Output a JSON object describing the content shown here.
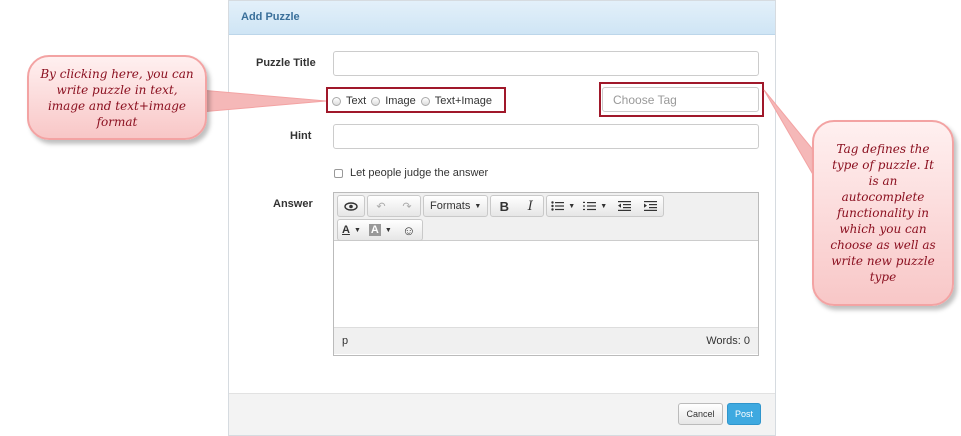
{
  "modal": {
    "title": "Add Puzzle",
    "fields": {
      "title_label": "Puzzle Title",
      "title_value": "",
      "hint_label": "Hint",
      "hint_value": "",
      "tag_placeholder": "Choose Tag",
      "answer_label": "Answer"
    },
    "format_options": [
      "Text",
      "Image",
      "Text+Image"
    ],
    "judge_label": "Let people judge the answer",
    "editor": {
      "formats_label": "Formats",
      "bold": "B",
      "italic": "I",
      "font_color": "A",
      "bg_color": "A",
      "status_path": "p",
      "word_count": "Words: 0"
    },
    "buttons": {
      "cancel": "Cancel",
      "post": "Post"
    }
  },
  "annotations": {
    "left_callout": "By clicking here, you can write puzzle in text, image and text+image format",
    "right_callout": "Tag defines the type of puzzle. It is an autocomplete functionality in which you can choose as well as write new puzzle type"
  },
  "colors": {
    "header_text": "#3a6f9a",
    "post_button": "#3ea9e0",
    "annotation_border": "#a0182a",
    "callout_text": "#8b1020"
  }
}
